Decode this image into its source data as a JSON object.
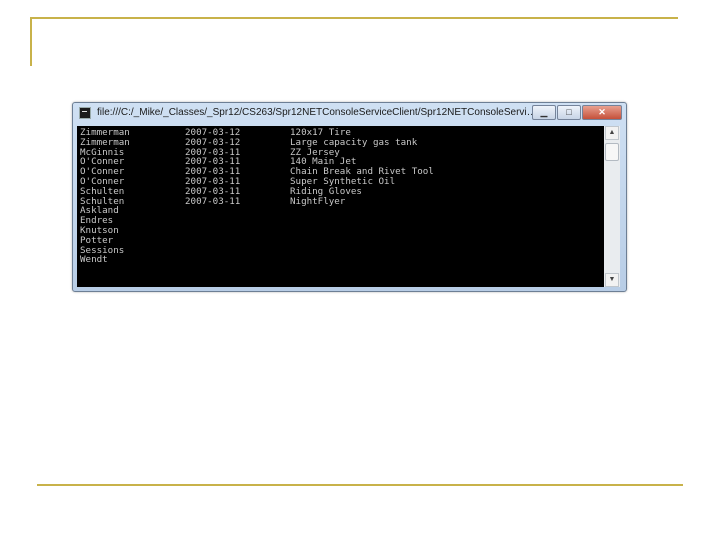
{
  "window": {
    "title": "file:///C:/_Mike/_Classes/_Spr12/CS263/Spr12NETConsoleServiceClient/Spr12NETConsoleServiceCli...",
    "controls": {
      "minimize": "▁",
      "maximize": "□",
      "close": "✕"
    }
  },
  "console": {
    "rows": [
      {
        "name": "Zimmerman",
        "date": "2007-03-12",
        "item": "120x17 Tire"
      },
      {
        "name": "Zimmerman",
        "date": "2007-03-12",
        "item": "Large capacity gas tank"
      },
      {
        "name": "McGinnis",
        "date": "2007-03-11",
        "item": "ZZ Jersey"
      },
      {
        "name": "O'Conner",
        "date": "2007-03-11",
        "item": "140 Main Jet"
      },
      {
        "name": "O'Conner",
        "date": "2007-03-11",
        "item": "Chain Break and Rivet Tool"
      },
      {
        "name": "O'Conner",
        "date": "2007-03-11",
        "item": "Super Synthetic Oil"
      },
      {
        "name": "Schulten",
        "date": "2007-03-11",
        "item": "Riding Gloves"
      },
      {
        "name": "Schulten",
        "date": "2007-03-11",
        "item": "NightFlyer"
      },
      {
        "name": "Askland",
        "date": "",
        "item": ""
      },
      {
        "name": "Endres",
        "date": "",
        "item": ""
      },
      {
        "name": "Knutson",
        "date": "",
        "item": ""
      },
      {
        "name": "Potter",
        "date": "",
        "item": ""
      },
      {
        "name": "Sessions",
        "date": "",
        "item": ""
      },
      {
        "name": "Wendt",
        "date": "",
        "item": ""
      }
    ]
  },
  "scrollbar": {
    "up_arrow": "▲",
    "down_arrow": "▼"
  },
  "colors": {
    "accent_line": "#c8b24a",
    "console_bg": "#000000",
    "console_text": "#c8c8c8"
  }
}
